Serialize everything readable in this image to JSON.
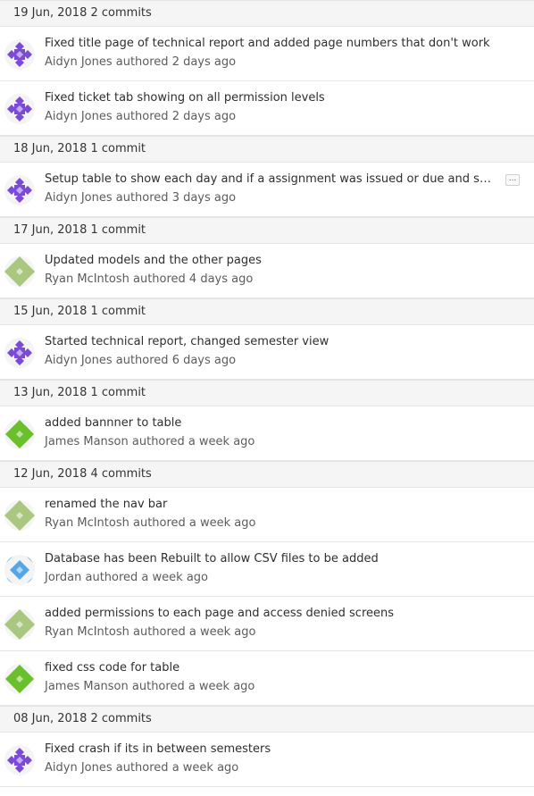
{
  "colors": {
    "purple": "#7b4bd6",
    "green": "#6bbf2c",
    "olive": "#a9c77e",
    "blue": "#55a6e6",
    "header_bg": "#f5f5f5",
    "border": "#e5e5e5"
  },
  "groups": [
    {
      "date": "19 Jun, 2018",
      "count": "2 commits",
      "commits": [
        {
          "title": "Fixed title page of technical report and added page numbers that don't work",
          "meta": "Aidyn Jones authored 2 days ago",
          "avatar": "purple-identicon"
        },
        {
          "title": "Fixed ticket tab showing on all permission levels",
          "meta": "Aidyn Jones authored 2 days ago",
          "avatar": "purple-identicon"
        }
      ]
    },
    {
      "date": "18 Jun, 2018",
      "count": "1 commit",
      "commits": [
        {
          "title": "Setup table to show each day and if a assignment was issued or due and show...",
          "meta": "Aidyn Jones authored 3 days ago",
          "avatar": "purple-identicon",
          "more": "..."
        }
      ]
    },
    {
      "date": "17 Jun, 2018",
      "count": "1 commit",
      "commits": [
        {
          "title": "Updated models and the other pages",
          "meta": "Ryan McIntosh authored 4 days ago",
          "avatar": "olive-identicon"
        }
      ]
    },
    {
      "date": "15 Jun, 2018",
      "count": "1 commit",
      "commits": [
        {
          "title": "Started technical report, changed semester view",
          "meta": "Aidyn Jones authored 6 days ago",
          "avatar": "purple-identicon"
        }
      ]
    },
    {
      "date": "13 Jun, 2018",
      "count": "1 commit",
      "commits": [
        {
          "title": "added bannner to table",
          "meta": "James Manson authored a week ago",
          "avatar": "green-identicon"
        }
      ]
    },
    {
      "date": "12 Jun, 2018",
      "count": "4 commits",
      "commits": [
        {
          "title": "renamed the nav bar",
          "meta": "Ryan McIntosh authored a week ago",
          "avatar": "olive-identicon"
        },
        {
          "title": "Database has been Rebuilt to allow CSV files to be added",
          "meta": "Jordan authored a week ago",
          "avatar": "blue-identicon"
        },
        {
          "title": "added permissions to each page and access denied screens",
          "meta": "Ryan McIntosh authored a week ago",
          "avatar": "olive-identicon"
        },
        {
          "title": "fixed css code for table",
          "meta": "James Manson authored a week ago",
          "avatar": "green-identicon"
        }
      ]
    },
    {
      "date": "08 Jun, 2018",
      "count": "2 commits",
      "commits": [
        {
          "title": "Fixed crash if its in between semesters",
          "meta": "Aidyn Jones authored a week ago",
          "avatar": "purple-identicon"
        }
      ]
    }
  ]
}
